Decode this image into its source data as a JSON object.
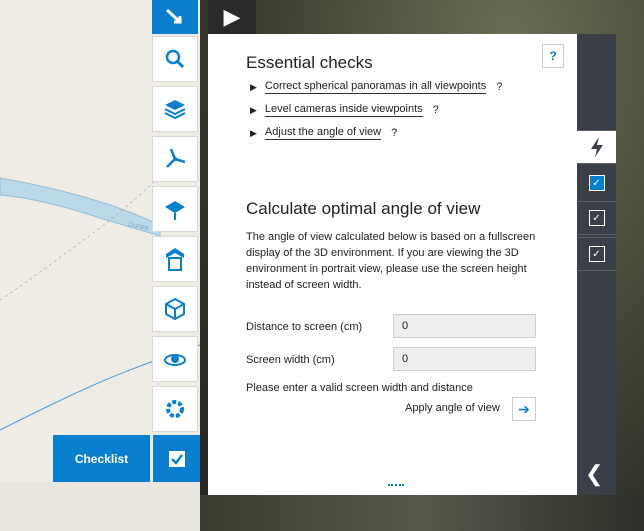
{
  "map": {
    "road_label": "Dunea"
  },
  "play": {
    "icon": "play-icon"
  },
  "toolbar": {
    "tools": [
      "navigate-icon",
      "search-icon",
      "layers-icon",
      "wind-turbine-icon",
      "solar-panel-icon",
      "building-icon",
      "3d-model-icon",
      "camera-viewpoint-icon",
      "settings-icon"
    ],
    "checklist_label": "Checklist"
  },
  "panel": {
    "help": "?",
    "essential_title": "Essential checks",
    "items": [
      {
        "label": "Correct spherical panoramas in all viewpoints",
        "q": "?"
      },
      {
        "label": "Level cameras inside viewpoints",
        "q": "?"
      },
      {
        "label": "Adjust the angle of view",
        "q": "?"
      }
    ],
    "calc_title": "Calculate optimal angle of view",
    "description": "The angle of view calculated below is based on a fullscreen display of the 3D environment. If you are viewing the 3D environment in portrait view, please use the screen height instead of screen width.",
    "distance_label": "Distance to screen (cm)",
    "distance_value": "0",
    "width_label": "Screen width (cm)",
    "width_value": "0",
    "warning": "Please enter a valid screen width and distance",
    "apply_label": "Apply angle of view"
  },
  "sidebar": {
    "buttons": [
      "lightning-icon",
      "checkbox-checked-blue",
      "checkbox-checked",
      "checkbox-checked"
    ],
    "collapse": "❮"
  },
  "colors": {
    "accent": "#0a7fd0",
    "sidebar": "#3a3f48"
  }
}
